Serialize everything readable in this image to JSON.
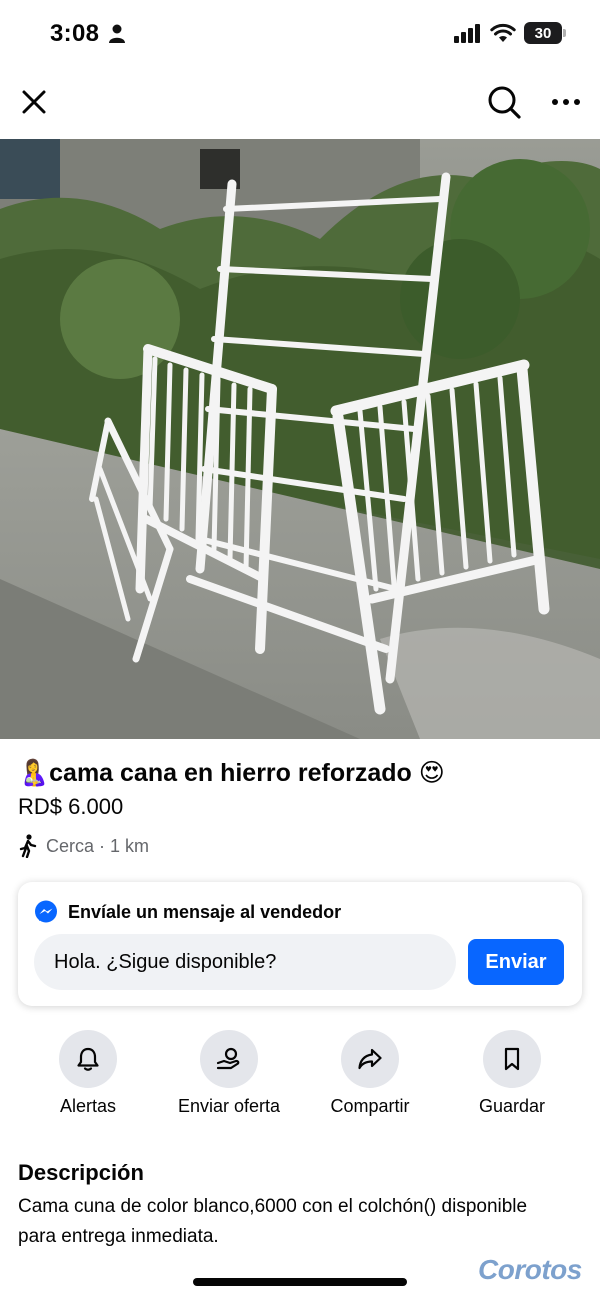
{
  "status_bar": {
    "time": "3:08",
    "battery": "30"
  },
  "nav": {
    "close_icon": "close-icon",
    "search_icon": "search-icon",
    "more_icon": "more-icon"
  },
  "photo": {
    "alt": "cama cuna blanca de hierro desarmada",
    "pages": 2,
    "current_page": 2
  },
  "listing": {
    "title_emoji_start": "🤱",
    "title": "cama cana en hierro reforzado",
    "title_emoji_end": "😍",
    "price": "RD$ 6.000",
    "location": "Cerca · 1 km"
  },
  "message": {
    "header": "Envíale un mensaje al vendedor",
    "input_value": "Hola. ¿Sigue disponible?",
    "send_label": "Enviar"
  },
  "actions": [
    {
      "label": "Alertas",
      "icon": "bell-icon"
    },
    {
      "label": "Enviar oferta",
      "icon": "offer-icon"
    },
    {
      "label": "Compartir",
      "icon": "share-icon"
    },
    {
      "label": "Guardar",
      "icon": "bookmark-icon"
    }
  ],
  "description": {
    "title": "Descripción",
    "text": "Cama cuna de color blanco,6000 con el colchón() disponible para entrega inmediata."
  },
  "watermark": "Corotos",
  "colors": {
    "accent": "#0866ff",
    "secondary_text": "#65676b",
    "action_bg": "#e4e6eb"
  }
}
